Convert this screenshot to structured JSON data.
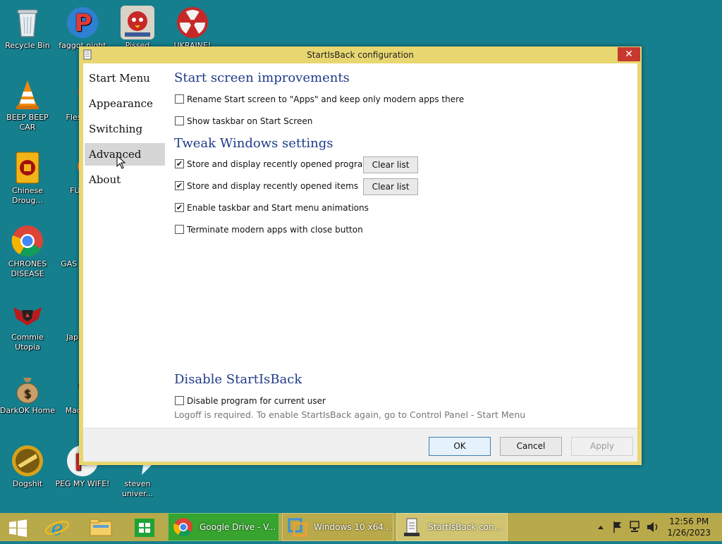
{
  "desktop_icons": [
    {
      "label": "Recycle Bin",
      "icon": "recycle-bin-icon"
    },
    {
      "label": "faggot night",
      "icon": "p-app-icon"
    },
    {
      "label": "Pissed",
      "icon": "angry-bird-seasons-icon"
    },
    {
      "label": "UKRAINE!",
      "icon": "radiation-icon"
    },
    {
      "label": "BEEP BEEP CAR",
      "icon": "vlc-cone-icon"
    },
    {
      "label": "Fles DEL",
      "icon": "red-flower-icon"
    },
    {
      "label": "Chinese Droug...",
      "icon": "chinese-lantern-icon"
    },
    {
      "label": "FURRY",
      "icon": "orange-circle-icon"
    },
    {
      "label": "CHRONES DISEASE",
      "icon": "chrome-icon"
    },
    {
      "label": "GAS S TWE",
      "icon": "white-flower-icon"
    },
    {
      "label": "Commie Utopia",
      "icon": "crest-icon"
    },
    {
      "label": "Japa Loli",
      "icon": "mahjong-icon"
    },
    {
      "label": "DarkOK Home",
      "icon": "money-bag-icon"
    },
    {
      "label": "Mad IN S",
      "icon": "colorful-game-icon"
    },
    {
      "label": "Dogshit",
      "icon": "dog-icon"
    },
    {
      "label": "PEG MY WIFE!",
      "icon": "red-p-icon"
    },
    {
      "label": "steven univer...",
      "icon": "blue-shape-icon"
    }
  ],
  "dialog": {
    "title": "StartIsBack configuration",
    "close_glyph": "✕",
    "nav": [
      "Start Menu",
      "Appearance",
      "Switching",
      "Advanced",
      "About"
    ],
    "active_nav": "Advanced",
    "sections": {
      "start_screen": {
        "title": "Start screen improvements",
        "options": [
          {
            "label": "Rename Start screen to \"Apps\" and keep only modern apps there",
            "checked": false
          },
          {
            "label": "Show taskbar on Start Screen",
            "checked": false
          }
        ]
      },
      "tweak": {
        "title": "Tweak Windows settings",
        "options": [
          {
            "label": "Store and display recently opened programs",
            "checked": true,
            "button": "Clear list"
          },
          {
            "label": "Store and display recently opened items",
            "checked": true,
            "button": "Clear list"
          },
          {
            "label": "Enable taskbar and Start menu animations",
            "checked": true
          },
          {
            "label": "Terminate modern apps with close button",
            "checked": false
          }
        ]
      },
      "disable": {
        "title": "Disable StartIsBack",
        "options": [
          {
            "label": "Disable program for current user",
            "checked": false
          }
        ],
        "note": "Logoff is required. To enable StartIsBack again, go to Control Panel - Start Menu"
      }
    },
    "buttons": {
      "ok": "OK",
      "cancel": "Cancel",
      "apply": "Apply"
    },
    "check_glyph": "✔"
  },
  "taskbar": {
    "apps": [
      {
        "label": "Google Drive - V...",
        "icon": "chrome-icon",
        "color": "#2e8b2e"
      },
      {
        "label": "Windows 10 x64 ...",
        "icon": "vmware-icon",
        "color": "#b8a94a"
      },
      {
        "label": "StartIsBack con...",
        "icon": "startisback-icon",
        "color": "#d0c470"
      }
    ],
    "tray": {
      "time": "12:56 PM",
      "date": "1/26/2023"
    }
  }
}
